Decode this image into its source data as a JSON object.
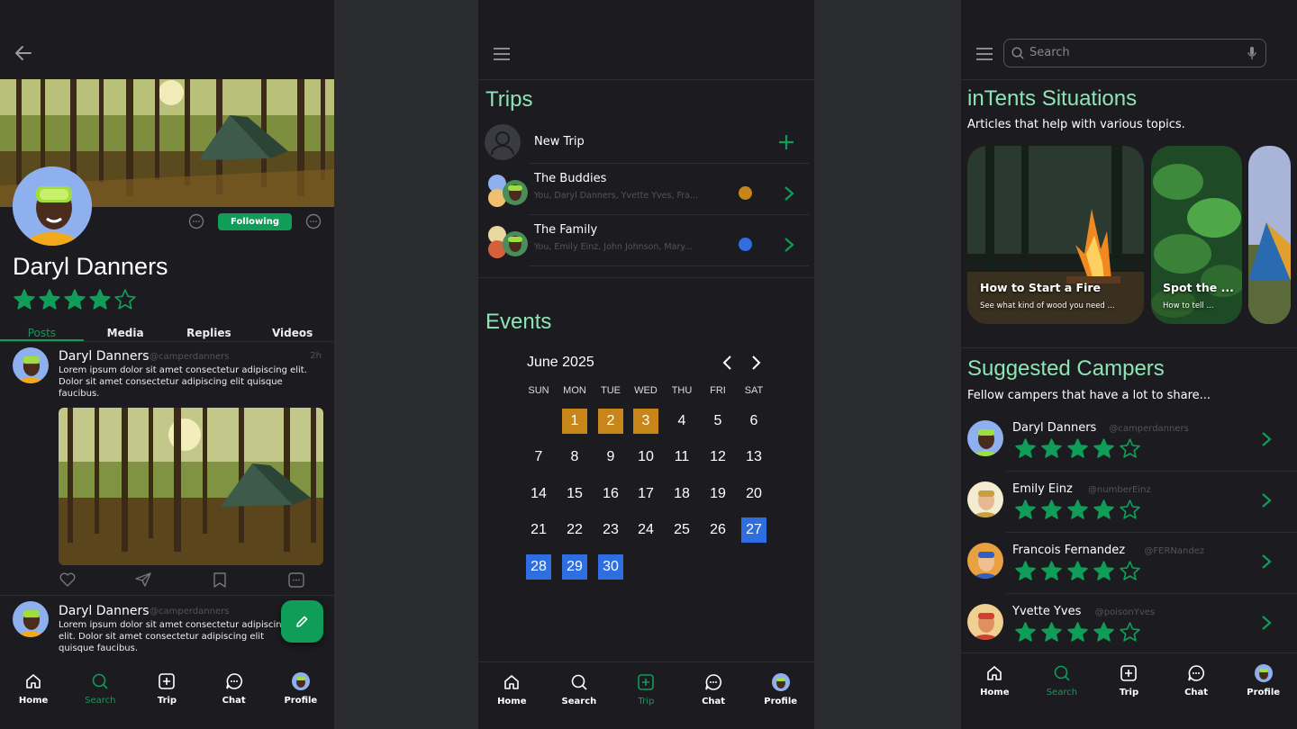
{
  "profile": {
    "name": "Daryl Danners",
    "following_label": "Following",
    "rating": 4,
    "tabs": [
      "Posts",
      "Media",
      "Replies",
      "Videos"
    ],
    "posts": [
      {
        "author": "Daryl Danners",
        "handle": "@camperdanners",
        "time": "2h",
        "text": "Lorem ipsum dolor sit amet consectetur adipiscing elit. Dolor sit amet consectetur adipiscing elit quisque faucibus."
      },
      {
        "author": "Daryl Danners",
        "handle": "@camperdanners",
        "text": "Lorem ipsum dolor sit amet consectetur adipiscing elit. Dolor sit amet consectetur adipiscing elit quisque faucibus."
      }
    ],
    "nav": [
      "Home",
      "Search",
      "Trip",
      "Chat",
      "Profile"
    ],
    "nav_active": "Search"
  },
  "trips": {
    "title": "Trips",
    "new_trip": "New Trip",
    "items": [
      {
        "name": "The Buddies",
        "members": "You, Daryl Danners, Yvette Yves, Fra...",
        "dot_color": "#c8861a"
      },
      {
        "name": "The Family",
        "members": "You, Emily Einz, John Johnson, Mary...",
        "dot_color": "#2f6ee0"
      }
    ],
    "events_title": "Events",
    "calendar": {
      "month_label": "June 2025",
      "weekdays": [
        "SUN",
        "MON",
        "TUE",
        "WED",
        "THU",
        "FRI",
        "SAT"
      ],
      "days": [
        "1",
        "2",
        "3",
        "4",
        "5",
        "6",
        "7",
        "8",
        "9",
        "10",
        "11",
        "12",
        "13",
        "14",
        "15",
        "16",
        "17",
        "18",
        "19",
        "20",
        "21",
        "22",
        "23",
        "24",
        "25",
        "26",
        "27",
        "28",
        "29",
        "30"
      ],
      "start_weekday": 1,
      "highlight_orange": [
        1,
        2,
        3
      ],
      "highlight_blue": [
        27,
        28,
        29,
        30
      ],
      "orange_color": "#c8861a",
      "blue_color": "#2f6ee0"
    },
    "nav": [
      "Home",
      "Search",
      "Trip",
      "Chat",
      "Profile"
    ],
    "nav_active": "Trip"
  },
  "discover": {
    "search_placeholder": "Search",
    "situations_title": "inTents Situations",
    "situations_subtitle": "Articles that help with various topics.",
    "cards": [
      {
        "title": "How to Start a Fire",
        "subtitle": "See what kind of wood you need ..."
      },
      {
        "title": "Spot the ...",
        "subtitle": "How to tell ..."
      }
    ],
    "suggested_title": "Suggested Campers",
    "suggested_subtitle": "Fellow campers that have a lot to share...",
    "campers": [
      {
        "name": "Daryl Danners",
        "handle": "@camperdanners",
        "rating": 4
      },
      {
        "name": "Emily Einz",
        "handle": "@numberEinz",
        "rating": 4
      },
      {
        "name": "Francois Fernandez",
        "handle": "@FERNandez",
        "rating": 4
      },
      {
        "name": "Yvette Yves",
        "handle": "@poisonYves",
        "rating": 4
      }
    ],
    "nav": [
      "Home",
      "Search",
      "Trip",
      "Chat",
      "Profile"
    ],
    "nav_active": "Search"
  },
  "colors": {
    "accent": "#0f9d58",
    "mint": "#8de5b5",
    "background": "#1c1b1f"
  }
}
